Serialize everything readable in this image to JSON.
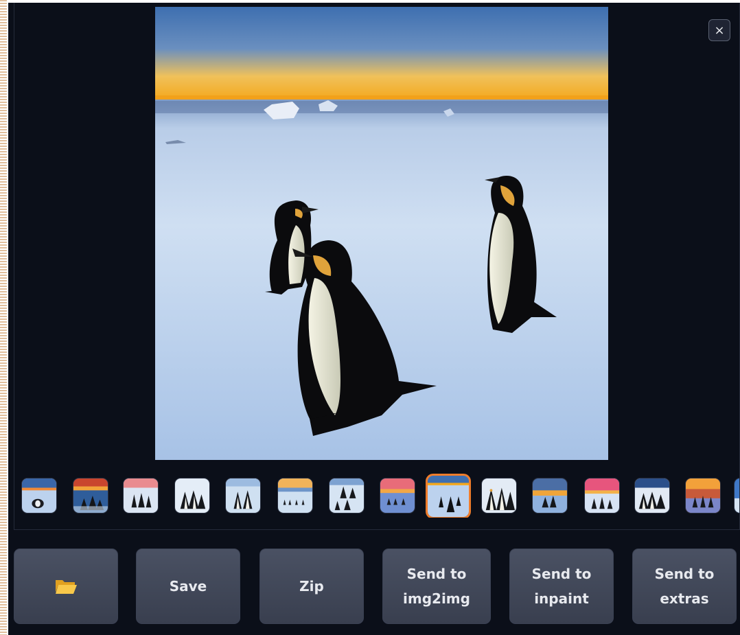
{
  "viewer": {
    "close_icon": "close-icon",
    "close_glyph": "×",
    "main_image": {
      "subject": "three penguins on ice at sunset",
      "sky_top": "#3e6fb0",
      "horizon": "#f4a81d"
    },
    "thumbnails": [
      {
        "icon": "penguin-thumbnail",
        "selected": false
      },
      {
        "icon": "penguin-thumbnail",
        "selected": false
      },
      {
        "icon": "penguin-thumbnail",
        "selected": false
      },
      {
        "icon": "penguin-thumbnail",
        "selected": false
      },
      {
        "icon": "penguin-thumbnail",
        "selected": false
      },
      {
        "icon": "penguin-thumbnail",
        "selected": false
      },
      {
        "icon": "penguin-thumbnail",
        "selected": false
      },
      {
        "icon": "penguin-thumbnail",
        "selected": false
      },
      {
        "icon": "penguin-thumbnail",
        "selected": true
      },
      {
        "icon": "penguin-thumbnail",
        "selected": false
      },
      {
        "icon": "penguin-thumbnail",
        "selected": false
      },
      {
        "icon": "penguin-thumbnail",
        "selected": false
      },
      {
        "icon": "penguin-thumbnail",
        "selected": false
      },
      {
        "icon": "penguin-thumbnail",
        "selected": false
      },
      {
        "icon": "penguin-thumbnail",
        "selected": false
      }
    ]
  },
  "actions": {
    "open_folder_icon": "folder-icon",
    "save_label": "Save",
    "zip_label": "Zip",
    "send_img2img_label": "Send to\nimg2img",
    "send_inpaint_label": "Send to\ninpaint",
    "send_extras_label": "Send to\nextras"
  },
  "colors": {
    "background": "#0b0f19",
    "button": "#434a5b",
    "selected_accent": "#f07c2a"
  }
}
